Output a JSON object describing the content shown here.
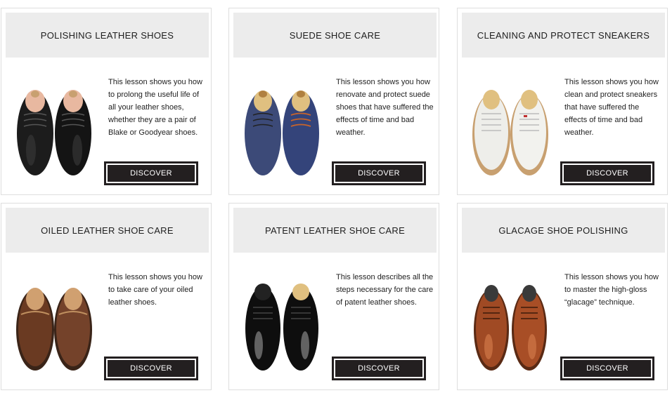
{
  "colors": {
    "header_bg": "#ececec",
    "button_bg": "#231f20",
    "button_text": "#ffffff",
    "border": "#dedede"
  },
  "cards": [
    {
      "title": "POLISHING LEATHER SHOES",
      "description": "This lesson shows you how to prolong the useful life of all your leather shoes, whether they are a pair of Blake or Goodyear shoes.",
      "button": "DISCOVER",
      "image": "black-leather-oxford-shoes"
    },
    {
      "title": "SUEDE SHOE CARE",
      "description": "This lesson shows you how renovate and protect suede shoes that have suffered the effects of time and bad weather.",
      "button": "DISCOVER",
      "image": "blue-suede-shoes"
    },
    {
      "title": "CLEANING AND PROTECT SNEAKERS",
      "description": "This lesson shows you how clean and protect sneakers that have suffered the effects of time and bad weather.",
      "button": "DISCOVER",
      "image": "white-sneakers"
    },
    {
      "title": "OILED LEATHER SHOE CARE",
      "description": "This lesson shows you how to take care of your oiled leather shoes.",
      "button": "DISCOVER",
      "image": "brown-boat-shoes"
    },
    {
      "title": "PATENT LEATHER SHOE CARE",
      "description": "This lesson describes all the steps necessary for the care of patent leather shoes.",
      "button": "DISCOVER",
      "image": "black-patent-shoes"
    },
    {
      "title": "GLACAGE SHOE POLISHING",
      "description": "This lesson shows you how to master the high-gloss “glacage” technique.",
      "button": "DISCOVER",
      "image": "tan-leather-oxford-shoes"
    }
  ]
}
